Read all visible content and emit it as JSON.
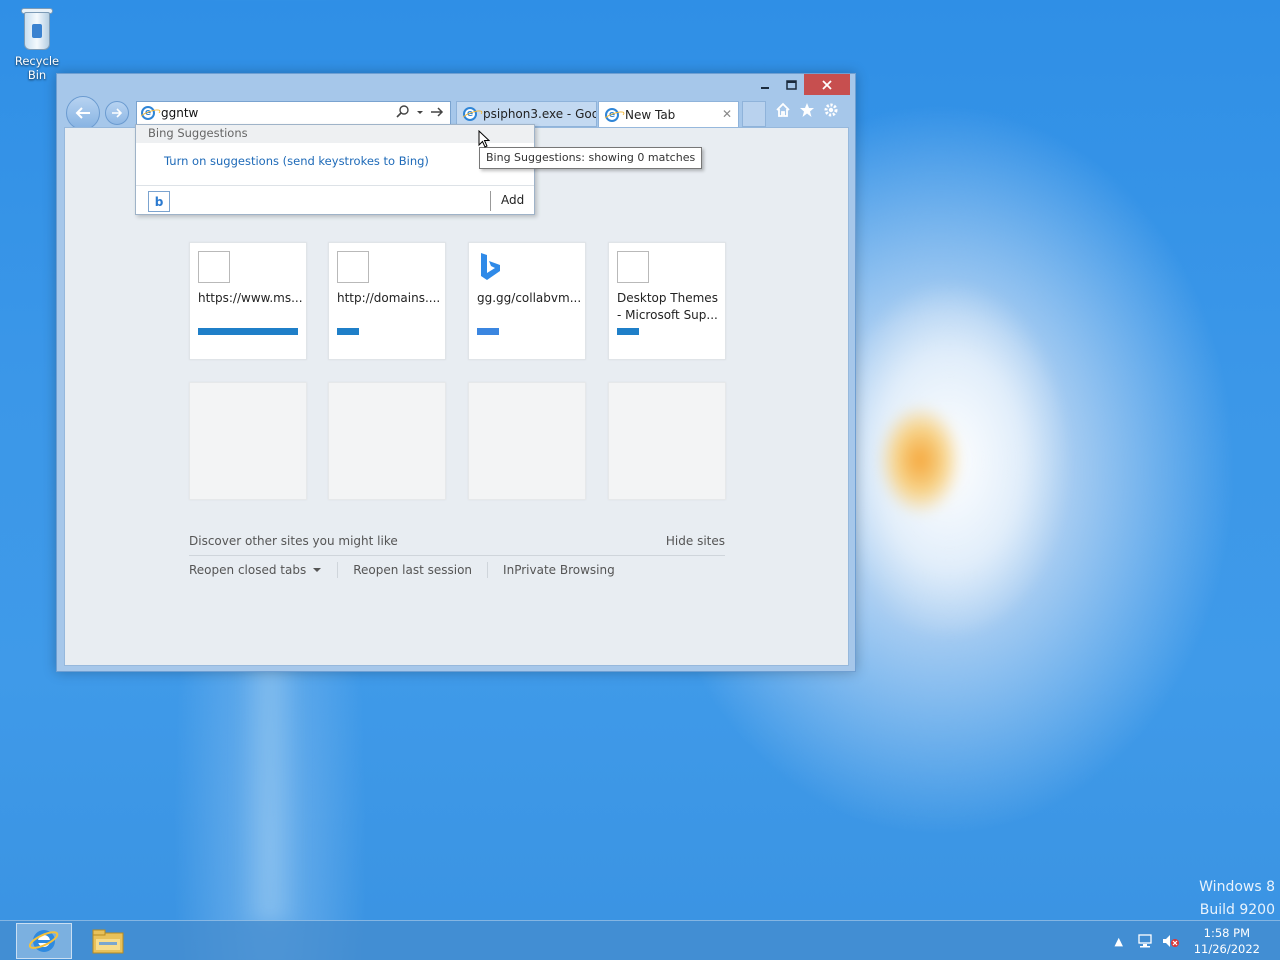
{
  "desktop": {
    "recycle_bin_label": "Recycle Bin",
    "watermark_line1": "Windows 8",
    "watermark_line2": "Build 9200"
  },
  "browser": {
    "address_value": "ggntw",
    "tabs": [
      {
        "label": "psiphon3.exe - Goo...",
        "active": false
      },
      {
        "label": "New Tab",
        "active": true
      }
    ],
    "toolbar_icons": [
      "home-icon",
      "favorites-star-icon",
      "settings-gear-icon"
    ]
  },
  "dropdown": {
    "header": "Bing Suggestions",
    "suggestion_link": "Turn on suggestions (send keystrokes to Bing)",
    "add_label": "Add",
    "provider_icon": "b"
  },
  "tooltip": "Bing Suggestions: showing 0 matches",
  "tiles": [
    {
      "title": "https://www.ms...",
      "bar_fraction": 0.98,
      "bar_color": "#1f7fc8",
      "icon": "blank"
    },
    {
      "title": "http://domains....",
      "bar_fraction": 0.22,
      "bar_color": "#1f7fc8",
      "icon": "blank"
    },
    {
      "title": "gg.gg/collabvm...",
      "bar_fraction": 0.22,
      "bar_color": "#3b86e0",
      "icon": "bing"
    },
    {
      "title": "Desktop Themes - Microsoft Sup...",
      "bar_fraction": 0.22,
      "bar_color": "#1f7fc8",
      "icon": "blank"
    }
  ],
  "new_tab_page": {
    "discover_label": "Discover other sites you might like",
    "hide_sites_label": "Hide sites",
    "reopen_closed_tabs": "Reopen closed tabs",
    "reopen_last_session": "Reopen last session",
    "inprivate_browsing": "InPrivate Browsing"
  },
  "taskbar": {
    "time": "1:58 PM",
    "date": "11/26/2022"
  }
}
